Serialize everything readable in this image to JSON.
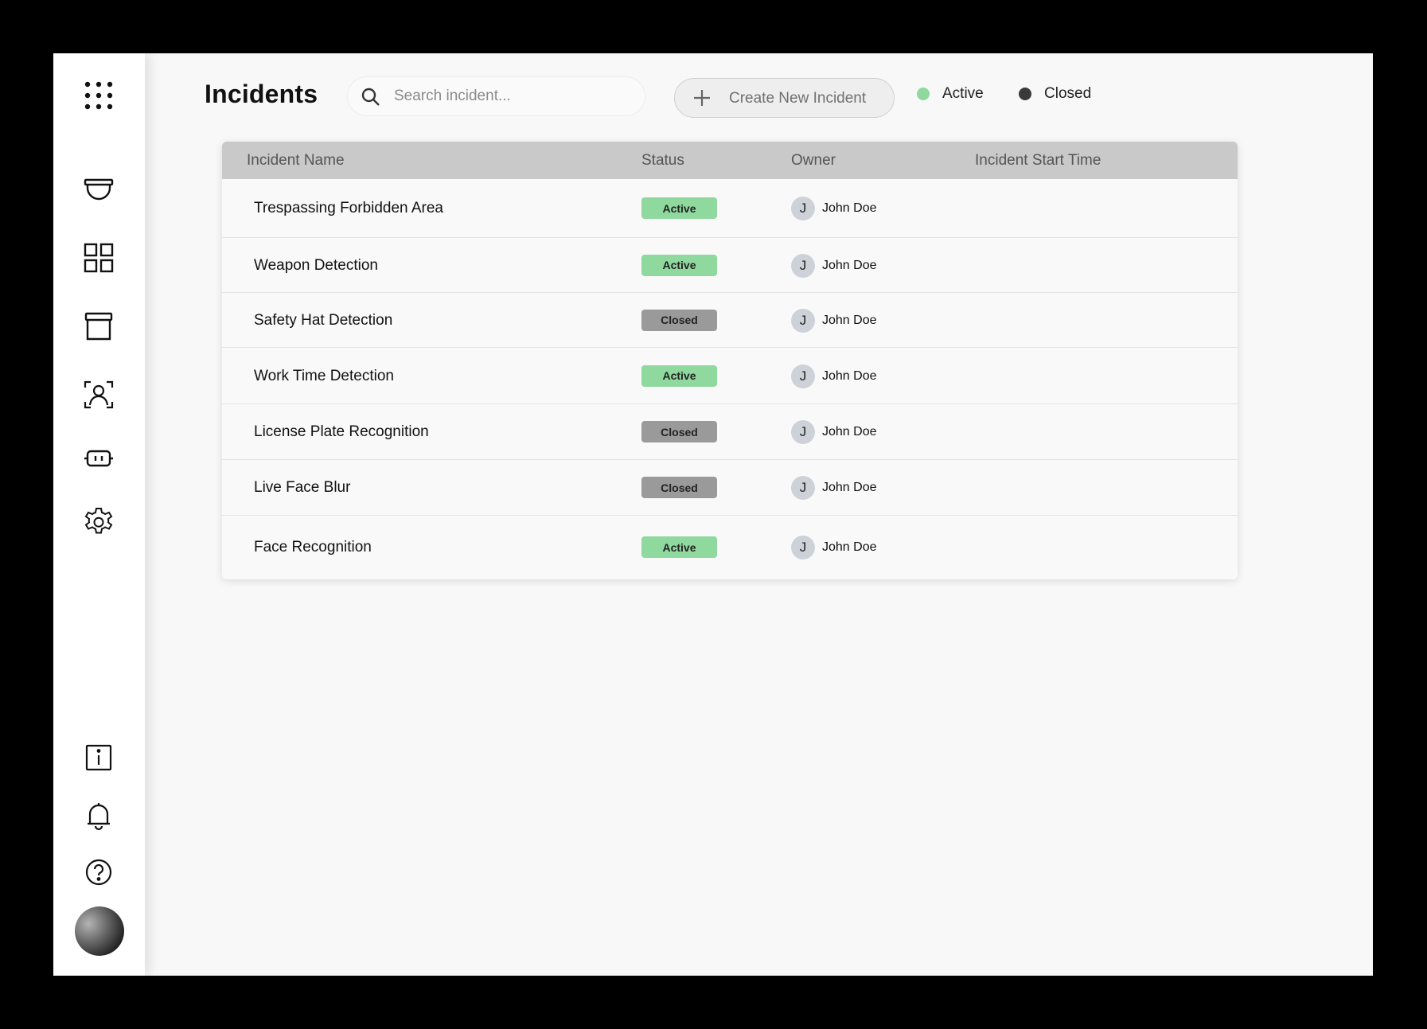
{
  "page": {
    "title": "Incidents"
  },
  "search": {
    "placeholder": "Search incident..."
  },
  "create_button": {
    "label": "Create New Incident"
  },
  "legend": [
    {
      "label": "Active",
      "color": "#8fd89e"
    },
    {
      "label": "Closed",
      "color": "#3a3a3a"
    }
  ],
  "sidebar": {
    "top_icons": [
      "apps-grid-icon",
      "camera-dome-icon",
      "dashboard-grid-icon",
      "archive-box-icon",
      "face-scan-icon",
      "robot-icon",
      "gear-icon"
    ],
    "bottom_icons": [
      "info-icon",
      "bell-icon",
      "help-icon"
    ]
  },
  "table": {
    "headers": [
      "Incident Name",
      "Status",
      "Owner",
      "Incident Start Time"
    ],
    "rows": [
      {
        "name": "Trespassing Forbidden Area",
        "status": "Active",
        "owner_initial": "J",
        "owner": "John Doe",
        "start_time": ""
      },
      {
        "name": "Weapon Detection",
        "status": "Active",
        "owner_initial": "J",
        "owner": "John Doe",
        "start_time": ""
      },
      {
        "name": "Safety Hat Detection",
        "status": "Closed",
        "owner_initial": "J",
        "owner": "John Doe",
        "start_time": ""
      },
      {
        "name": "Work Time Detection",
        "status": "Active",
        "owner_initial": "J",
        "owner": "John Doe",
        "start_time": ""
      },
      {
        "name": "License Plate Recognition",
        "status": "Closed",
        "owner_initial": "J",
        "owner": "John Doe",
        "start_time": ""
      },
      {
        "name": "Live Face Blur",
        "status": "Closed",
        "owner_initial": "J",
        "owner": "John Doe",
        "start_time": ""
      },
      {
        "name": "Face Recognition",
        "status": "Active",
        "owner_initial": "J",
        "owner": "John Doe",
        "start_time": ""
      }
    ]
  }
}
